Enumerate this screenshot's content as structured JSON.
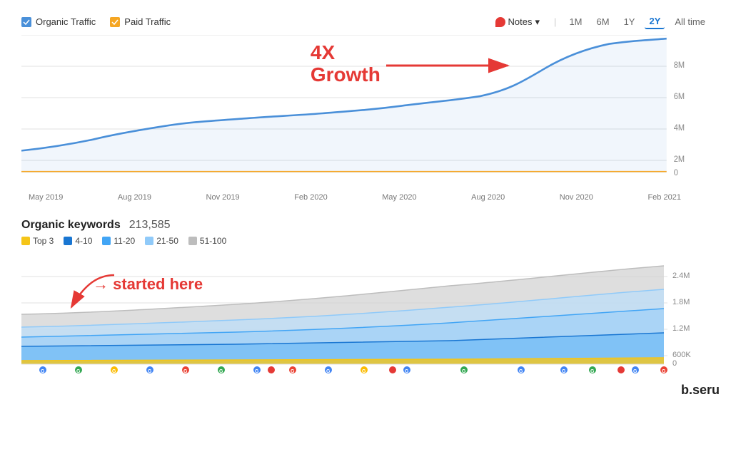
{
  "header": {
    "legend": [
      {
        "label": "Organic Traffic",
        "color": "#4a90d9",
        "type": "organic"
      },
      {
        "label": "Paid Traffic",
        "color": "#f5a623",
        "type": "paid"
      }
    ],
    "notes_label": "Notes",
    "chevron": "▾",
    "time_periods": [
      "1M",
      "6M",
      "1Y",
      "2Y",
      "All time"
    ],
    "active_period": "2Y"
  },
  "top_chart": {
    "annotation_text": "4X\nGrowth",
    "x_labels": [
      "May 2019",
      "Aug 2019",
      "Nov 2019",
      "Feb 2020",
      "May 2020",
      "Aug 2020",
      "Nov 2020",
      "Feb 2021"
    ],
    "y_labels": [
      "0",
      "2M",
      "4M",
      "6M",
      "8M"
    ]
  },
  "bottom_section": {
    "title": "Organic keywords",
    "count": "213,585",
    "legend_items": [
      {
        "label": "Top 3",
        "color": "#f5c518"
      },
      {
        "label": "4-10",
        "color": "#1976d2"
      },
      {
        "label": "11-20",
        "color": "#42a5f5"
      },
      {
        "label": "21-50",
        "color": "#90caf9"
      },
      {
        "label": "51-100",
        "color": "#bdbdbd"
      }
    ],
    "annotation": "started here",
    "y_labels": [
      "0",
      "600K",
      "1.2M",
      "1.8M",
      "2.4M"
    ]
  },
  "watermark": "b.seru"
}
